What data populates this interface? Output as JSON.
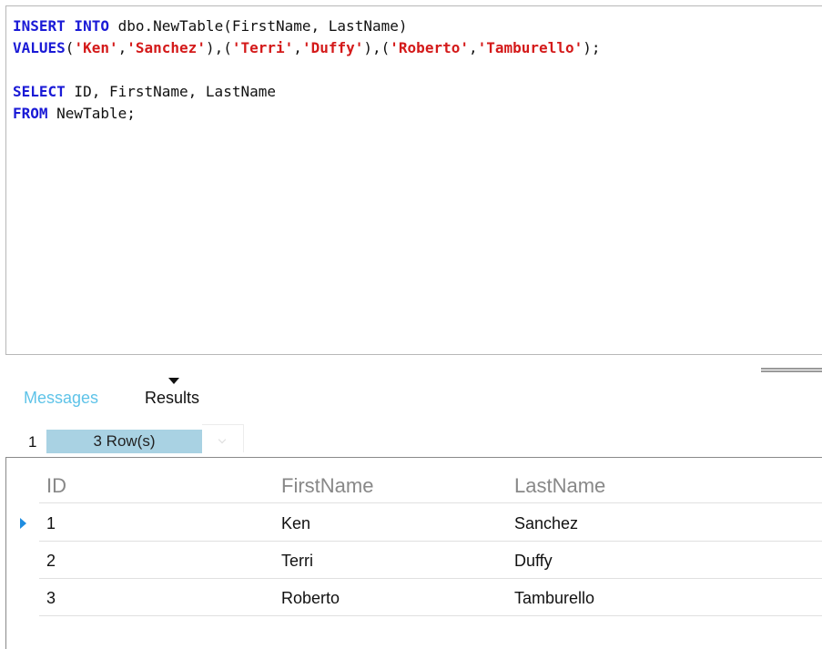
{
  "editor": {
    "lines": [
      [
        {
          "t": "INSERT INTO",
          "k": "kw"
        },
        {
          "t": " dbo.NewTable(FirstName, LastName)",
          "k": "plain"
        }
      ],
      [
        {
          "t": "VALUES",
          "k": "kw"
        },
        {
          "t": "(",
          "k": "plain"
        },
        {
          "t": "'Ken'",
          "k": "str"
        },
        {
          "t": ",",
          "k": "plain"
        },
        {
          "t": "'Sanchez'",
          "k": "str"
        },
        {
          "t": "),(",
          "k": "plain"
        },
        {
          "t": "'Terri'",
          "k": "str"
        },
        {
          "t": ",",
          "k": "plain"
        },
        {
          "t": "'Duffy'",
          "k": "str"
        },
        {
          "t": "),(",
          "k": "plain"
        },
        {
          "t": "'Roberto'",
          "k": "str"
        },
        {
          "t": ",",
          "k": "plain"
        },
        {
          "t": "'Tamburello'",
          "k": "str"
        },
        {
          "t": ");",
          "k": "plain"
        }
      ],
      [],
      [
        {
          "t": "SELECT",
          "k": "kw"
        },
        {
          "t": " ID, FirstName, LastName",
          "k": "plain"
        }
      ],
      [
        {
          "t": "FROM",
          "k": "kw"
        },
        {
          "t": " NewTable;",
          "k": "plain"
        }
      ]
    ]
  },
  "tabs": {
    "messages": "Messages",
    "results": "Results"
  },
  "result_sets": {
    "index": "1",
    "badge": "3 Row(s)"
  },
  "grid": {
    "headers": [
      "ID",
      "FirstName",
      "LastName"
    ],
    "rows": [
      [
        "1",
        "Ken",
        "Sanchez"
      ],
      [
        "2",
        "Terri",
        "Duffy"
      ],
      [
        "3",
        "Roberto",
        "Tamburello"
      ]
    ]
  },
  "colors": {
    "keyword": "#1a1ad6",
    "string": "#d41a1a",
    "active_tab": "#5ec3e8",
    "row_badge": "#a9d2e3",
    "row_indicator": "#1f8de0"
  }
}
